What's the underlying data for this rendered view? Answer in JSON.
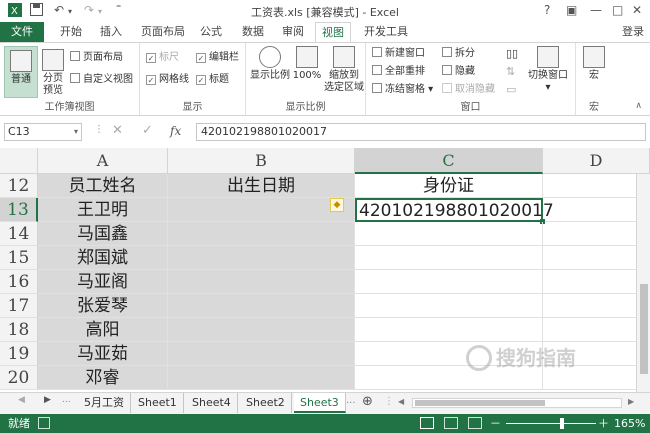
{
  "titlebar": {
    "title": "工资表.xls  [兼容模式] - Excel",
    "help": "?",
    "ribbon_opts": "▣",
    "minimize": "—",
    "restore": "□",
    "close": "✕"
  },
  "tabs": {
    "file": "文件",
    "items": [
      "开始",
      "插入",
      "页面布局",
      "公式",
      "数据",
      "审阅",
      "视图",
      "开发工具"
    ],
    "active": "视图",
    "signin": "登录"
  },
  "ribbon": {
    "workbook_views": {
      "label": "工作簿视图",
      "normal": "普通",
      "page_break": "分页\n预览",
      "page_layout": "页面布局",
      "custom_views": "自定义视图"
    },
    "show": {
      "label": "显示",
      "ruler": "标尺",
      "formula_bar": "编辑栏",
      "gridlines": "网格线",
      "headings": "标题"
    },
    "zoom": {
      "label": "显示比例",
      "zoom": "显示比例",
      "hundred": "100%",
      "to_selection": "缩放到\n选定区域"
    },
    "window": {
      "label": "窗口",
      "new_window": "新建窗口",
      "arrange_all": "全部重排",
      "freeze_panes": "冻结窗格",
      "split": "拆分",
      "hide": "隐藏",
      "unhide": "取消隐藏",
      "switch_windows": "切换窗口"
    },
    "macros": {
      "label": "宏",
      "macros": "宏"
    }
  },
  "formula_bar": {
    "namebox": "C13",
    "fx": "fx",
    "value": "420102198801020017"
  },
  "grid": {
    "columns": [
      "A",
      "B",
      "C",
      "D"
    ],
    "header_row": {
      "row": "12",
      "a": "员工姓名",
      "b": "出生日期",
      "c": "身份证"
    },
    "rows": [
      {
        "row": "13",
        "name": "王卫明",
        "id": "420102198801020017"
      },
      {
        "row": "14",
        "name": "马国鑫",
        "id": ""
      },
      {
        "row": "15",
        "name": "郑国斌",
        "id": ""
      },
      {
        "row": "16",
        "name": "马亚阁",
        "id": ""
      },
      {
        "row": "17",
        "name": "张爱琴",
        "id": ""
      },
      {
        "row": "18",
        "name": "高阳",
        "id": ""
      },
      {
        "row": "19",
        "name": "马亚茹",
        "id": ""
      },
      {
        "row": "20",
        "name": "邓睿",
        "id": ""
      }
    ]
  },
  "sheets": {
    "tabs": [
      "5月工资",
      "Sheet1",
      "Sheet4",
      "Sheet2",
      "Sheet3"
    ],
    "active": "Sheet3",
    "more": "...",
    "add": "⊕"
  },
  "status": {
    "ready": "就绪",
    "zoom": "165%",
    "minus": "－",
    "plus": "＋"
  },
  "watermark": "搜狗指南",
  "colors": {
    "accent": "#217346",
    "header_bg": "#f3f3f3",
    "grid": "#e1e1e1"
  }
}
